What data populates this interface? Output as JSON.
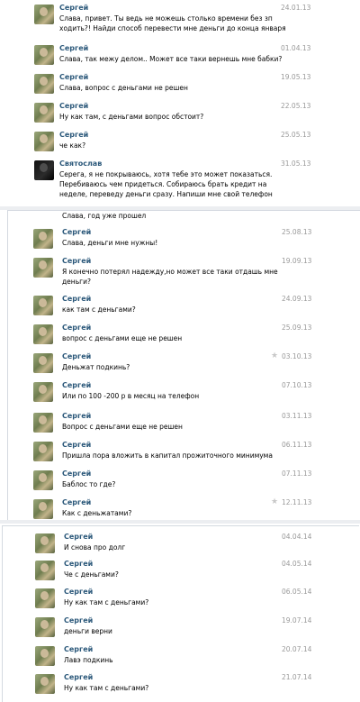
{
  "panel1": [
    {
      "name": "Сергей",
      "date": "24.01.13",
      "lines": [
        "Слава, привет. Ты ведь не можешь столько времени без зп",
        "ходить?! Найди способ перевести мне деньги до конца января"
      ]
    },
    {
      "name": "Сергей",
      "date": "01.04.13",
      "lines": [
        "Слава, так межу делом.. Может все таки вернешь мне бабки?"
      ]
    },
    {
      "name": "Сергей",
      "date": "19.05.13",
      "lines": [
        "Слава, вопрос с деньгами не решен"
      ]
    },
    {
      "name": "Сергей",
      "date": "22.05.13",
      "lines": [
        "Ну как там, с деньгами вопрос обстоит?"
      ]
    },
    {
      "name": "Сергей",
      "date": "25.05.13",
      "lines": [
        "че как?"
      ]
    },
    {
      "name": "Святослав",
      "date": "31.05.13",
      "lines": [
        "Серега, я не покрываюсь, хотя тебе это может показаться.",
        "Перебиваюсь чем придеться. Собираюсь брать кредит на",
        "неделе, переведу деньги сразу. Напиши мне свой телефон"
      ]
    }
  ],
  "panel2_cut_text": "Слава, год уже прошел",
  "panel2": [
    {
      "name": "Сергей",
      "date": "25.08.13",
      "lines": [
        "Слава, деньги мне нужны!"
      ]
    },
    {
      "name": "Сергей",
      "date": "19.09.13",
      "lines": [
        "Я конечно потерял надежду,но может все таки отдашь мне",
        "деньги?"
      ]
    },
    {
      "name": "Сергей",
      "date": "24.09.13",
      "lines": [
        "как там с деньгами?"
      ]
    },
    {
      "name": "Сергей",
      "date": "25.09.13",
      "lines": [
        "вопрос с деньгами еще не решен"
      ]
    },
    {
      "name": "Сергей",
      "date": "03.10.13",
      "lines": [
        "Деньжат подкинь?"
      ],
      "star": true
    },
    {
      "name": "Сергей",
      "date": "07.10.13",
      "lines": [
        "Или по 100 -200 р в месяц на телефон"
      ]
    },
    {
      "name": "Сергей",
      "date": "03.11.13",
      "lines": [
        "Вопрос с деньгами еще не решен"
      ]
    },
    {
      "name": "Сергей",
      "date": "06.11.13",
      "lines": [
        "Пришла пора вложить в капитал прожиточного минимума"
      ]
    },
    {
      "name": "Сергей",
      "date": "07.11.13",
      "lines": [
        "Баблос то где?"
      ]
    },
    {
      "name": "Сергей",
      "date": "12.11.13",
      "lines": [
        "Как с деньжатами?"
      ],
      "star": true
    }
  ],
  "panel3": [
    {
      "name": "Сергей",
      "date": "04.04.14",
      "lines": [
        "И снова про долг"
      ]
    },
    {
      "name": "Сергей",
      "date": "04.05.14",
      "lines": [
        "Че с деньгами?"
      ]
    },
    {
      "name": "Сергей",
      "date": "06.05.14",
      "lines": [
        "Ну как там с деньгами?"
      ]
    },
    {
      "name": "Сергей",
      "date": "19.07.14",
      "lines": [
        "деньги верни"
      ]
    },
    {
      "name": "Сергей",
      "date": "20.07.14",
      "lines": [
        "Лавэ подкинь"
      ]
    },
    {
      "name": "Сергей",
      "date": "21.07.14",
      "lines": [
        "Ну как там с деньгами?"
      ]
    }
  ],
  "star_glyph": "★"
}
